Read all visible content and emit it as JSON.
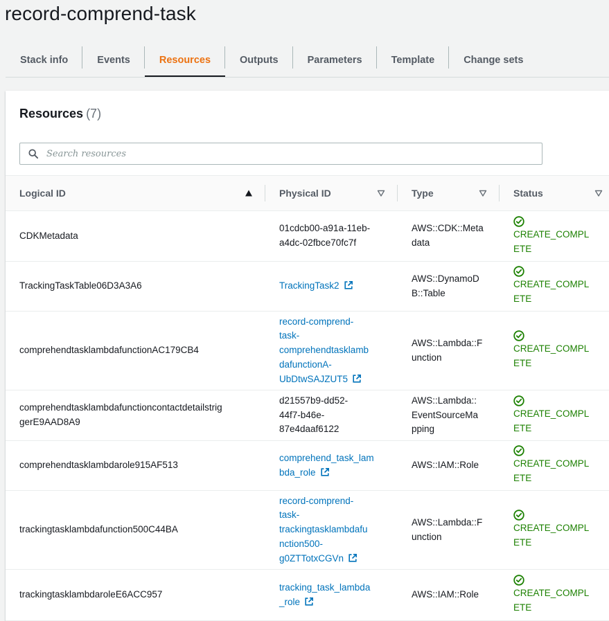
{
  "page": {
    "title": "record-comprend-task"
  },
  "tabs": [
    {
      "label": "Stack info",
      "active": false
    },
    {
      "label": "Events",
      "active": false
    },
    {
      "label": "Resources",
      "active": true
    },
    {
      "label": "Outputs",
      "active": false
    },
    {
      "label": "Parameters",
      "active": false
    },
    {
      "label": "Template",
      "active": false
    },
    {
      "label": "Change sets",
      "active": false
    }
  ],
  "resources": {
    "heading": "Resources",
    "count": "(7)",
    "search_placeholder": "Search resources",
    "columns": {
      "logical_id": "Logical ID",
      "physical_id": "Physical ID",
      "type": "Type",
      "status": "Status"
    },
    "rows": [
      {
        "logical_id": "CDKMetadata",
        "physical_id_lines": [
          "01cdcb00-a91a-11eb-",
          "a4dc-02fbce70fc7f"
        ],
        "physical_is_link": false,
        "type_lines": [
          "AWS::CDK::Meta",
          "data"
        ],
        "status_lines": [
          "CREATE_COMPL",
          "ETE"
        ]
      },
      {
        "logical_id": "TrackingTaskTable06D3A3A6",
        "physical_id_lines": [
          "TrackingTask2"
        ],
        "physical_is_link": true,
        "type_lines": [
          "AWS::DynamoD",
          "B::Table"
        ],
        "status_lines": [
          "CREATE_COMPL",
          "ETE"
        ]
      },
      {
        "logical_id": "comprehendtasklambdafunctionAC179CB4",
        "physical_id_lines": [
          "record-comprend-",
          "task-",
          "comprehendtasklamb",
          "dafunctionA-",
          "UbDtwSAJZUT5"
        ],
        "physical_is_link": true,
        "type_lines": [
          "AWS::Lambda::F",
          "unction"
        ],
        "status_lines": [
          "CREATE_COMPL",
          "ETE"
        ]
      },
      {
        "logical_id_lines": [
          "comprehendtasklambdafunctioncontactdetailstrig",
          "gerE9AAD8A9"
        ],
        "physical_id_lines": [
          "d21557b9-dd52-",
          "44f7-b46e-",
          "87e4daaf6122"
        ],
        "physical_is_link": false,
        "type_lines": [
          "AWS::Lambda::",
          "EventSourceMa",
          "pping"
        ],
        "status_lines": [
          "CREATE_COMPL",
          "ETE"
        ]
      },
      {
        "logical_id": "comprehendtasklambdarole915AF513",
        "physical_id_lines": [
          "comprehend_task_lam",
          "bda_role"
        ],
        "physical_is_link": true,
        "type_lines": [
          "AWS::IAM::Role"
        ],
        "status_lines": [
          "CREATE_COMPL",
          "ETE"
        ]
      },
      {
        "logical_id": "trackingtasklambdafunction500C44BA",
        "physical_id_lines": [
          "record-comprend-",
          "task-",
          "trackingtasklambdafu",
          "nction500-",
          "g0ZTTotxCGVn"
        ],
        "physical_is_link": true,
        "type_lines": [
          "AWS::Lambda::F",
          "unction"
        ],
        "status_lines": [
          "CREATE_COMPL",
          "ETE"
        ]
      },
      {
        "logical_id": "trackingtasklambdaroleE6ACC957",
        "physical_id_lines": [
          "tracking_task_lambda",
          "_role"
        ],
        "physical_is_link": true,
        "type_lines": [
          "AWS::IAM::Role"
        ],
        "status_lines": [
          "CREATE_COMPL",
          "ETE"
        ]
      }
    ]
  },
  "colors": {
    "accent_tab": "#ec7211",
    "link": "#0073bb",
    "success": "#1d8102"
  },
  "icons": {
    "search": "search-icon",
    "sort_asc": "caret-up-icon",
    "sort_desc": "caret-down-outline-icon",
    "external": "external-link-icon",
    "status_ok": "check-circle-icon"
  }
}
